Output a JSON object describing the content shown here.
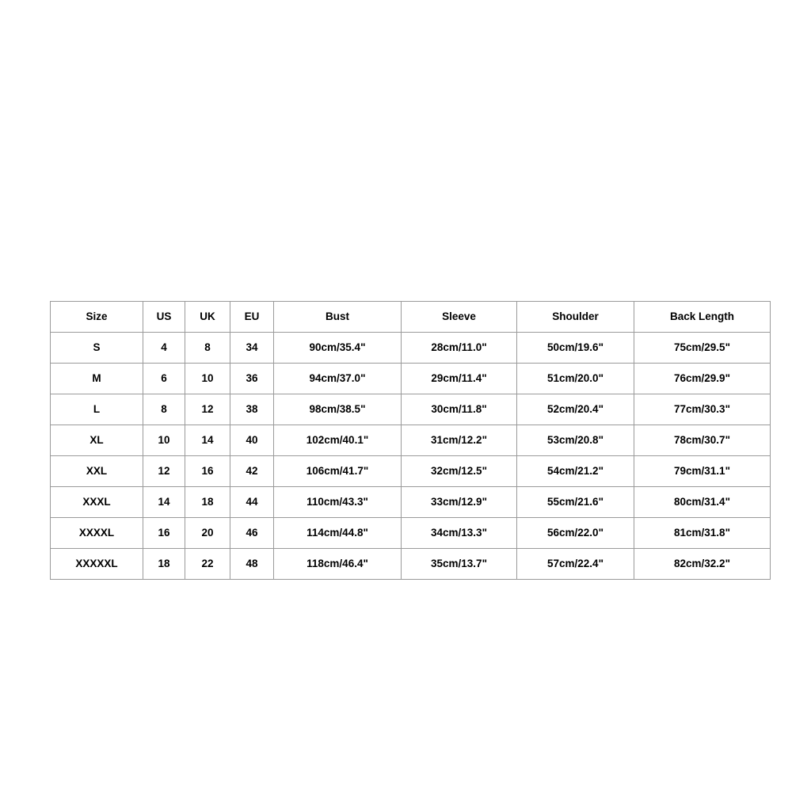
{
  "chart_data": {
    "type": "table",
    "title": "",
    "columns": [
      "Size",
      "US",
      "UK",
      "EU",
      "Bust",
      "Sleeve",
      "Shoulder",
      "Back Length"
    ],
    "rows": [
      [
        "S",
        "4",
        "8",
        "34",
        "90cm/35.4\"",
        "28cm/11.0\"",
        "50cm/19.6\"",
        "75cm/29.5\""
      ],
      [
        "M",
        "6",
        "10",
        "36",
        "94cm/37.0\"",
        "29cm/11.4\"",
        "51cm/20.0\"",
        "76cm/29.9\""
      ],
      [
        "L",
        "8",
        "12",
        "38",
        "98cm/38.5\"",
        "30cm/11.8\"",
        "52cm/20.4\"",
        "77cm/30.3\""
      ],
      [
        "XL",
        "10",
        "14",
        "40",
        "102cm/40.1\"",
        "31cm/12.2\"",
        "53cm/20.8\"",
        "78cm/30.7\""
      ],
      [
        "XXL",
        "12",
        "16",
        "42",
        "106cm/41.7\"",
        "32cm/12.5\"",
        "54cm/21.2\"",
        "79cm/31.1\""
      ],
      [
        "XXXL",
        "14",
        "18",
        "44",
        "110cm/43.3\"",
        "33cm/12.9\"",
        "55cm/21.6\"",
        "80cm/31.4\""
      ],
      [
        "XXXXL",
        "16",
        "20",
        "46",
        "114cm/44.8\"",
        "34cm/13.3\"",
        "56cm/22.0\"",
        "81cm/31.8\""
      ],
      [
        "XXXXXL",
        "18",
        "22",
        "48",
        "118cm/46.4\"",
        "35cm/13.7\"",
        "57cm/22.4\"",
        "82cm/32.2\""
      ]
    ]
  },
  "colors": {
    "page_background": "#ffffff",
    "cell_background": "#ffffff",
    "border": "#9a9a9a",
    "text": "#000000"
  }
}
